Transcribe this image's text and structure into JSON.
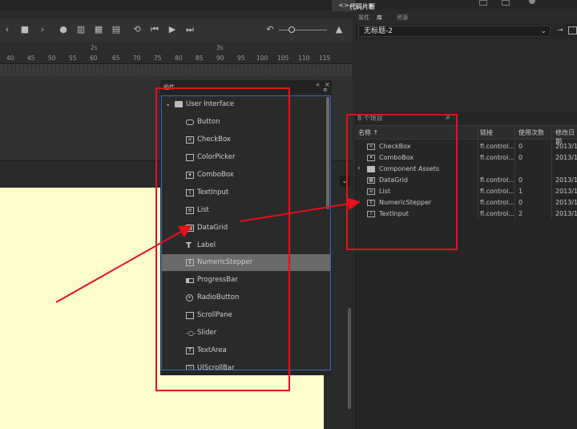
{
  "top": {
    "code_snippets_label": "代码片断"
  },
  "timeline": {
    "ruler_labels": [
      "40",
      "45",
      "50",
      "55",
      "60",
      "65",
      "70",
      "75",
      "80",
      "85",
      "90",
      "95",
      "100",
      "105",
      "110",
      "115"
    ],
    "seconds_marker_1": "2s",
    "seconds_marker_2": "3s"
  },
  "components_panel": {
    "title": "組件",
    "group": "User Interface",
    "items": [
      {
        "label": "Button",
        "icon": "button-icon"
      },
      {
        "label": "CheckBox",
        "icon": "checkbox-icon"
      },
      {
        "label": "ColorPicker",
        "icon": "colorpicker-icon"
      },
      {
        "label": "ComboBox",
        "icon": "combobox-icon"
      },
      {
        "label": "TextInput",
        "icon": "textinput-icon"
      },
      {
        "label": "List",
        "icon": "list-icon"
      },
      {
        "label": "DataGrid",
        "icon": "datagrid-icon"
      },
      {
        "label": "Label",
        "icon": "label-icon"
      },
      {
        "label": "NumericStepper",
        "icon": "numericstepper-icon",
        "selected": true
      },
      {
        "label": "ProgressBar",
        "icon": "progressbar-icon"
      },
      {
        "label": "RadioButton",
        "icon": "radiobutton-icon"
      },
      {
        "label": "ScrollPane",
        "icon": "scrollpane-icon"
      },
      {
        "label": "Slider",
        "icon": "slider-icon"
      },
      {
        "label": "TextArea",
        "icon": "textarea-icon"
      },
      {
        "label": "UIScrollBar",
        "icon": "uiscrollbar-icon"
      }
    ]
  },
  "library": {
    "tabs": [
      "属性",
      "库",
      "资源"
    ],
    "document": "无标题-2",
    "item_count": "8 个项目",
    "columns": {
      "name": "名称 ↑",
      "linkage": "链接",
      "use_count": "使用次数",
      "modified": "修改日期"
    },
    "rows": [
      {
        "name": "CheckBox",
        "linkage": "fl.control...",
        "count": "0",
        "date": "2013/1"
      },
      {
        "name": "ComboBox",
        "linkage": "fl.control...",
        "count": "0",
        "date": "2013/1"
      },
      {
        "name": "Component Assets",
        "linkage": "",
        "count": "",
        "date": "",
        "folder": true
      },
      {
        "name": "DataGrid",
        "linkage": "fl.control...",
        "count": "0",
        "date": "2013/1"
      },
      {
        "name": "List",
        "linkage": "fl.control...",
        "count": "1",
        "date": "2013/1"
      },
      {
        "name": "NumericStepper",
        "linkage": "fl.control...",
        "count": "0",
        "date": "2013/1"
      },
      {
        "name": "TextInput",
        "linkage": "fl.control...",
        "count": "2",
        "date": "2013/1"
      }
    ]
  },
  "annotation_color": "#e8101a"
}
